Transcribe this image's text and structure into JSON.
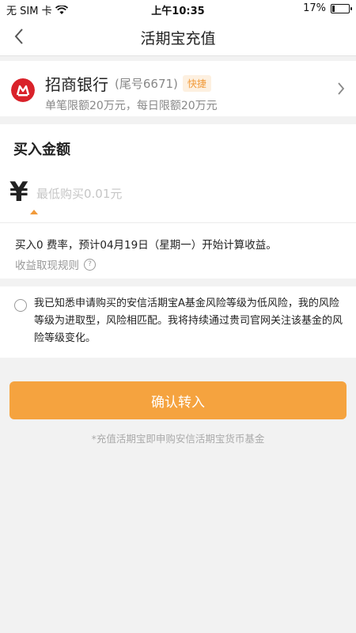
{
  "status_bar": {
    "carrier": "无 SIM 卡",
    "time": "上午10:35",
    "battery": "17%",
    "battery_level": 0.17
  },
  "nav": {
    "title": "活期宝充值"
  },
  "bank": {
    "name": "招商银行",
    "tail": "(尾号6671)",
    "tag": "快捷",
    "limit": "单笔限额20万元，每日限额20万元",
    "brand_color": "#d9222a"
  },
  "amount": {
    "label": "买入金额",
    "currency": "¥",
    "placeholder": "最低购买0.01元"
  },
  "info": {
    "line": "买入0  费率，预计04月19日（星期一）开始计算收益。",
    "rule_link": "收益取现规则"
  },
  "agreement": {
    "text": "我已知悉申请购买的安信活期宝A基金风险等级为低风险，我的风险等级为进取型，风险相匹配。我将持续通过贵司官网关注该基金的风险等级变化。"
  },
  "confirm_button": {
    "label": "确认转入",
    "color": "#f5a33f"
  },
  "footnote": "*充值活期宝即申购安信活期宝货币基金"
}
